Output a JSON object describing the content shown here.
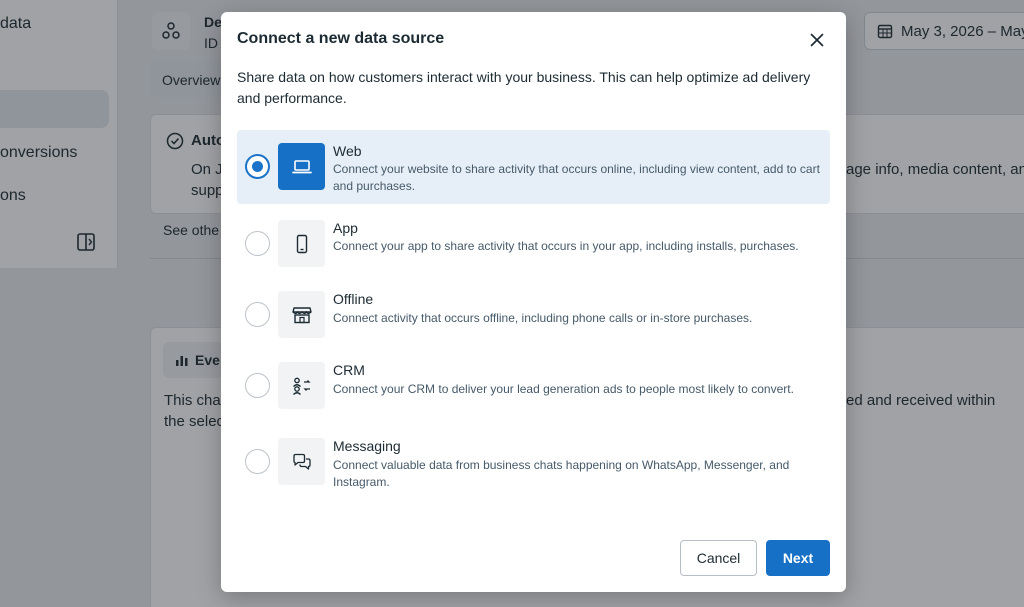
{
  "background": {
    "sidebar": {
      "items": [
        "data",
        "onversions",
        "ons"
      ]
    },
    "header": {
      "title_partial": "De",
      "id_partial": "ID",
      "date": "May 3, 2026 – May"
    },
    "tabs": {
      "overview": "Overview"
    },
    "auto_section": {
      "heading_partial": "Auto",
      "line1_partial": "On J",
      "line2_partial": "supp",
      "right_text": "age info, media content, and",
      "see_other": "See othe"
    },
    "events_section": {
      "heading_partial": "Eve",
      "line1_partial": "This chan",
      "line2_partial": "the selec",
      "right_text": "ed and received within"
    }
  },
  "modal": {
    "title": "Connect a new data source",
    "description": "Share data on how customers interact with your business. This can help optimize ad delivery and performance.",
    "options": [
      {
        "title": "Web",
        "description": "Connect your website to share activity that occurs online, including view content, add to cart and purchases.",
        "icon": "laptop-icon",
        "selected": true
      },
      {
        "title": "App",
        "description": "Connect your app to share activity that occurs in your app, including installs, purchases.",
        "icon": "mobile-phone-icon",
        "selected": false
      },
      {
        "title": "Offline",
        "description": "Connect activity that occurs offline, including phone calls or in-store purchases.",
        "icon": "storefront-icon",
        "selected": false
      },
      {
        "title": "CRM",
        "description": "Connect your CRM to deliver your lead generation ads to people most likely to convert.",
        "icon": "people-sync-icon",
        "selected": false
      },
      {
        "title": "Messaging",
        "description": "Connect valuable data from business chats happening on WhatsApp, Messenger, and Instagram.",
        "icon": "chat-bubbles-icon",
        "selected": false
      }
    ],
    "cancel_label": "Cancel",
    "next_label": "Next"
  },
  "colors": {
    "accent": "#1670c5",
    "selected_bg": "#e6eff8",
    "overlay": "#1c2128"
  }
}
